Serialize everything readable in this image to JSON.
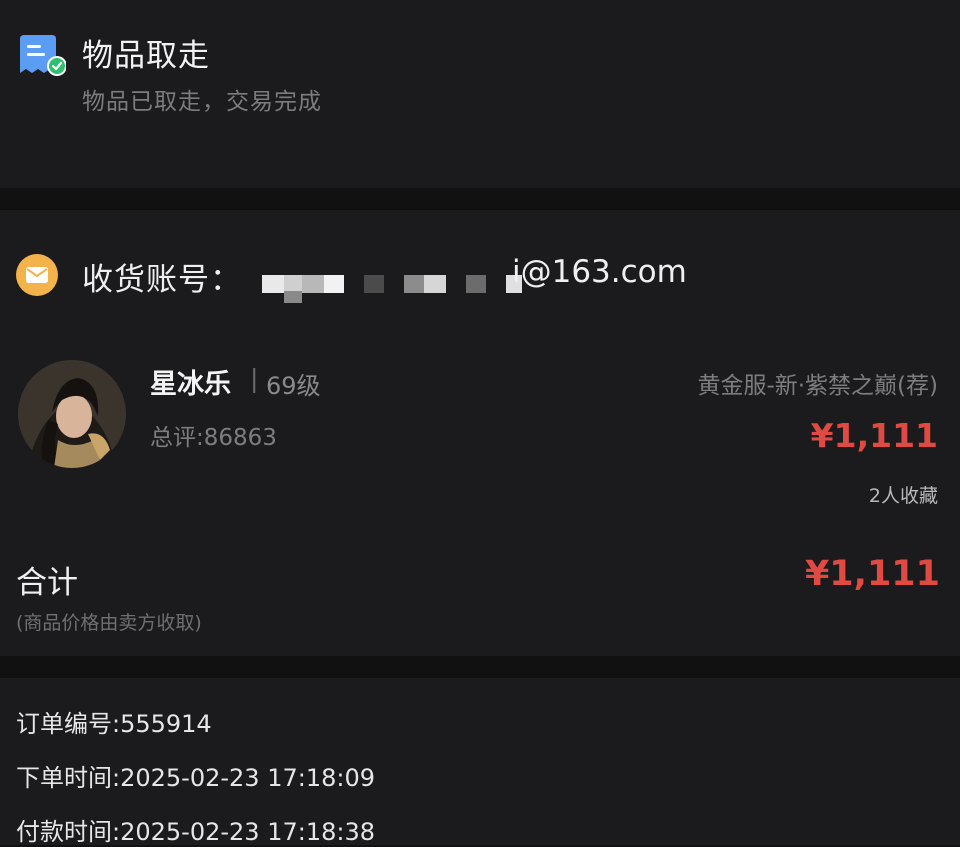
{
  "status": {
    "icon": "receipt-check-icon",
    "title": "物品取走",
    "subtitle": "物品已取走，交易完成"
  },
  "account": {
    "icon": "mail-icon",
    "label": "收货账号：",
    "email_suffix": "i@163.com"
  },
  "seller": {
    "name": "星冰乐",
    "separator": "|",
    "level": "69级",
    "score": "总评:86863",
    "server": "黄金服-新·紫禁之巅(荐)",
    "price": "¥1,111",
    "favorites": "2人收藏"
  },
  "total": {
    "label": "合计",
    "price": "¥1,111",
    "note": "(商品价格由卖方收取)"
  },
  "order": {
    "number": "订单编号:555914",
    "order_time": "下单时间:2025-02-23 17:18:09",
    "pay_time": "付款时间:2025-02-23 17:18:38"
  },
  "colors": {
    "background": "#111111",
    "card": "#1b1b1d",
    "price": "#e04a43",
    "mail_icon": "#f3b24a",
    "status_icon": "#5b9df2",
    "check": "#2fbf71"
  }
}
